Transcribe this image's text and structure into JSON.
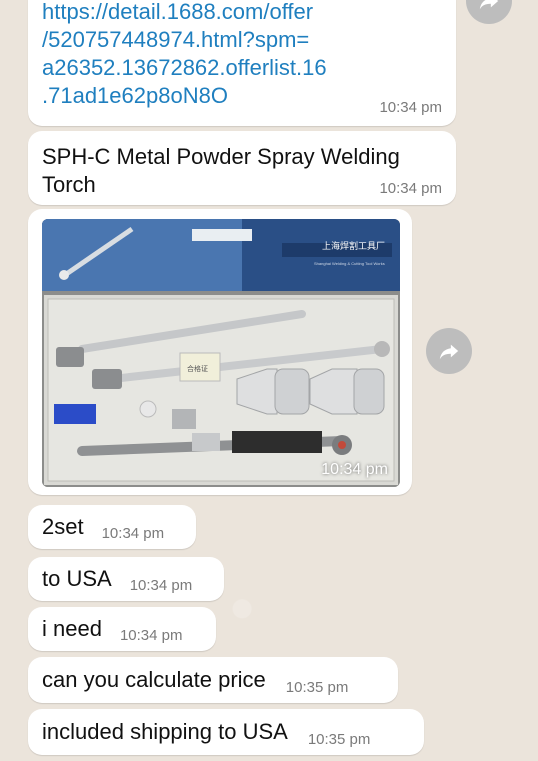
{
  "messages": {
    "link": {
      "url_lines": [
        "https://detail.1688.com/offer",
        "/520757448974.html?spm=",
        "a26352.13672862.offerlist.16",
        ".71ad1e62p8oN8O"
      ],
      "time": "10:34 pm"
    },
    "product": {
      "text_lines": [
        "SPH-C Metal Powder Spray Welding",
        "Torch"
      ],
      "time": "10:34 pm"
    },
    "photo": {
      "time": "10:34 pm",
      "box_text": "上海焊割工具厂",
      "box_subtext": "Shanghai Welding & Cutting Tool Works",
      "label": "合格证"
    },
    "m1": {
      "text": "2set",
      "time": "10:34 pm"
    },
    "m2": {
      "text": "to USA",
      "time": "10:34 pm"
    },
    "m3": {
      "text": "i need",
      "time": "10:34 pm"
    },
    "m4": {
      "text": "can you calculate price",
      "time": "10:35 pm"
    },
    "m5": {
      "text": "included shipping to USA",
      "time": "10:35 pm"
    }
  },
  "icons": {
    "forward": "forward-arrow-icon"
  }
}
